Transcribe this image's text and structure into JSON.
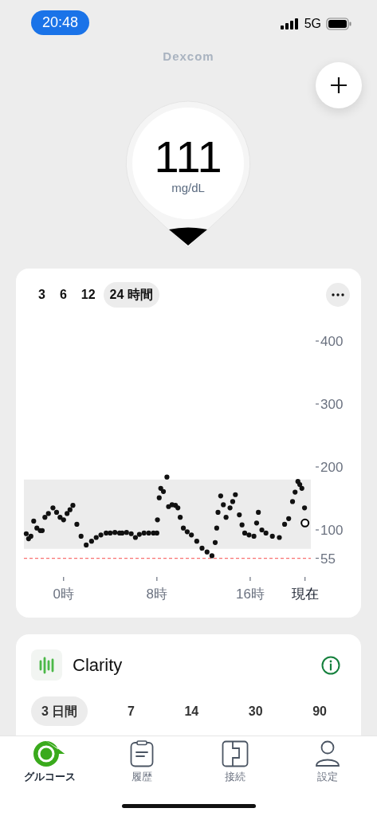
{
  "status_bar": {
    "time": "20:48",
    "network": "5G"
  },
  "brand": "Dexcom",
  "reading": {
    "value": "111",
    "unit": "mg/dL"
  },
  "glucose_card": {
    "ranges": [
      {
        "label": "3",
        "selected": false
      },
      {
        "label": "6",
        "selected": false
      },
      {
        "label": "12",
        "selected": false
      },
      {
        "label": "24 時間",
        "selected": true
      }
    ],
    "chart_data": {
      "type": "scatter",
      "xlim": [
        -3.4,
        21.2
      ],
      "ylim": [
        55,
        400
      ],
      "xticks": [
        {
          "value": 0,
          "label": "0時"
        },
        {
          "value": 8,
          "label": "8時"
        },
        {
          "value": 16,
          "label": "16時"
        },
        {
          "value": 20.7,
          "label": "現在"
        }
      ],
      "yticks": [
        {
          "value": 400,
          "label": "400"
        },
        {
          "value": 300,
          "label": "300"
        },
        {
          "value": 200,
          "label": "200"
        },
        {
          "value": 100,
          "label": "100"
        },
        {
          "value": 55,
          "label": "55"
        }
      ],
      "x": [
        -3.2,
        -3.0,
        -2.8,
        -2.56,
        -2.29,
        -2.0,
        -1.83,
        -1.6,
        -1.3,
        -0.91,
        -0.6,
        -0.3,
        0,
        0.3,
        0.55,
        0.8,
        1.14,
        1.5,
        1.94,
        2.4,
        2.8,
        3.2,
        3.65,
        4.0,
        4.4,
        4.8,
        5.02,
        5.4,
        5.8,
        6.16,
        6.5,
        6.9,
        7.3,
        7.7,
        8.0,
        8.05,
        8.2,
        8.33,
        8.56,
        8.86,
        9.0,
        9.3,
        9.59,
        9.8,
        10.0,
        10.27,
        10.6,
        10.96,
        11.42,
        11.87,
        12.3,
        12.72,
        13.0,
        13.13,
        13.24,
        13.47,
        13.7,
        13.93,
        14.27,
        14.5,
        14.73,
        15.07,
        15.3,
        15.53,
        15.9,
        16.32,
        16.55,
        16.7,
        17.0,
        17.35,
        17.9,
        18.5,
        18.95,
        19.3,
        19.63,
        19.85,
        20.09,
        20.25,
        20.43,
        20.66
      ],
      "series": [
        {
          "color": "#111111",
          "marker": "circle",
          "values": [
            94,
            86,
            90,
            114,
            103,
            99,
            99,
            120,
            126,
            135,
            128,
            120,
            116,
            126,
            132,
            139,
            109,
            90,
            76,
            82,
            88,
            92,
            95,
            95,
            96,
            95,
            95,
            96,
            94,
            88,
            93,
            95,
            95,
            95,
            95,
            116,
            151,
            166,
            161,
            184,
            137,
            140,
            139,
            135,
            120,
            103,
            97,
            92,
            82,
            71,
            65,
            59,
            80,
            103,
            128,
            154,
            140,
            120,
            135,
            145,
            156,
            124,
            108,
            95,
            92,
            90,
            111,
            128,
            100,
            95,
            90,
            88,
            109,
            118,
            145,
            160,
            177,
            172,
            166,
            135
          ]
        }
      ],
      "bands": [
        {
          "axis": "y",
          "from": 70,
          "to": 180
        }
      ],
      "ref_lines": [
        {
          "axis": "y",
          "value": 55,
          "color": "#f87171"
        }
      ]
    }
  },
  "clarity_card": {
    "title": "Clarity",
    "ranges": [
      {
        "label": "3 日間",
        "selected": true
      },
      {
        "label": "7",
        "selected": false
      },
      {
        "label": "14",
        "selected": false
      },
      {
        "label": "30",
        "selected": false
      },
      {
        "label": "90",
        "selected": false
      }
    ]
  },
  "tab_bar": [
    {
      "label": "グルコース",
      "kind": "glucose",
      "selected": true
    },
    {
      "label": "履歴",
      "kind": "history",
      "selected": false
    },
    {
      "label": "接続",
      "kind": "connect",
      "selected": false
    },
    {
      "label": "設定",
      "kind": "settings",
      "selected": false
    }
  ]
}
